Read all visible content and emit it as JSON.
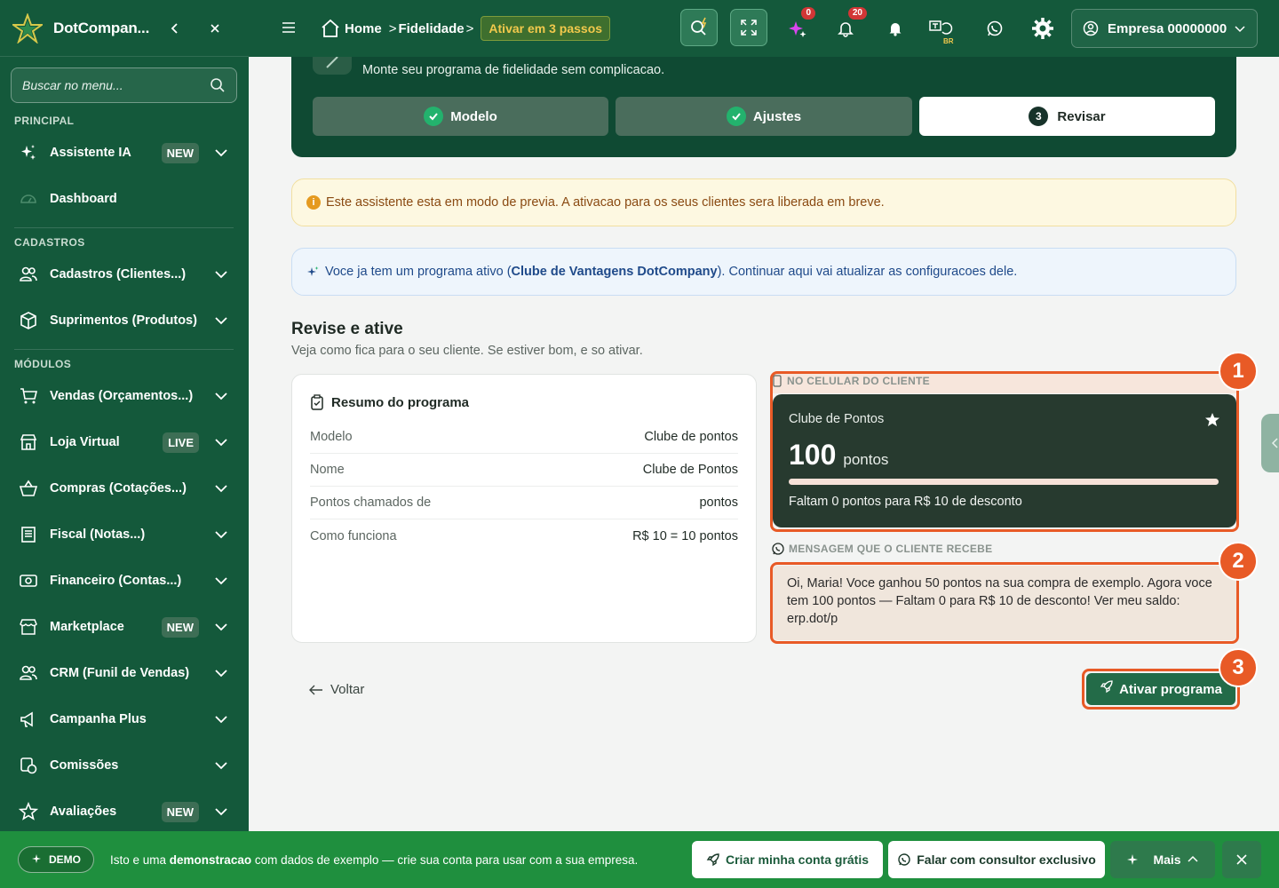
{
  "sidebar": {
    "app_name": "DotCompan...",
    "search_placeholder": "Buscar no menu...",
    "sections": {
      "principal": "PRINCIPAL",
      "cadastros": "CADASTROS",
      "modulos": "MÓDULOS"
    },
    "items": [
      {
        "label": "Assistente IA",
        "badge": "NEW",
        "icon": "sparkles-icon"
      },
      {
        "label": "Dashboard",
        "icon": "gauge-icon"
      },
      {
        "label": "Cadastros (Clientes...)",
        "icon": "users-icon"
      },
      {
        "label": "Suprimentos (Produtos)",
        "icon": "box-icon"
      },
      {
        "label": "Vendas (Orçamentos...)",
        "icon": "cart-icon"
      },
      {
        "label": "Loja Virtual",
        "badge": "LIVE",
        "icon": "store-icon"
      },
      {
        "label": "Compras (Cotações...)",
        "icon": "basket-icon"
      },
      {
        "label": "Fiscal (Notas...)",
        "icon": "receipt-icon"
      },
      {
        "label": "Financeiro (Contas...)",
        "icon": "money-icon"
      },
      {
        "label": "Marketplace",
        "badge": "NEW",
        "icon": "marketplace-icon"
      },
      {
        "label": "CRM (Funil de Vendas)",
        "icon": "users-icon"
      },
      {
        "label": "Campanha Plus",
        "icon": "megaphone-icon"
      },
      {
        "label": "Comissões",
        "icon": "commission-icon"
      },
      {
        "label": "Avaliações",
        "badge": "NEW",
        "icon": "star-icon"
      }
    ]
  },
  "topbar": {
    "breadcrumb": {
      "home": "Home",
      "current": "Fidelidade",
      "sep": ">",
      "badge": "Ativar em 3 passos"
    },
    "notif_counts": {
      "ai": "0",
      "bell": "20"
    },
    "lang": "BR",
    "account": "Empresa 00000000"
  },
  "hero": {
    "subtitle": "Monte seu programa de fidelidade sem complicacao.",
    "steps": [
      {
        "label": "Modelo",
        "state": "done"
      },
      {
        "label": "Ajustes",
        "state": "done"
      },
      {
        "label": "Revisar",
        "number": "3",
        "state": "current"
      }
    ]
  },
  "alerts": {
    "warning": "Este assistente esta em modo de previa. A ativacao para os seus clientes sera liberada em breve.",
    "info_prefix": "Voce ja tem um programa ativo (",
    "info_program": "Clube de Vantagens DotCompany",
    "info_suffix": "). Continuar aqui vai atualizar as configuracoes dele."
  },
  "review": {
    "title": "Revise e ative",
    "description": "Veja como fica para o seu cliente. Se estiver bom, e so ativar.",
    "summary_title": "Resumo do programa",
    "rows": [
      {
        "key": "Modelo",
        "value": "Clube de pontos"
      },
      {
        "key": "Nome",
        "value": "Clube de Pontos"
      },
      {
        "key": "Pontos chamados de",
        "value": "pontos"
      },
      {
        "key": "Como funciona",
        "value": "R$ 10 = 10 pontos"
      }
    ]
  },
  "preview": {
    "phone_label": "NO CELULAR DO CLIENTE",
    "card_title": "Clube de Pontos",
    "points": "100",
    "points_unit": "pontos",
    "progress": 1.0,
    "progress_text": "Faltam 0 pontos para R$ 10 de desconto",
    "message_label": "MENSAGEM QUE O CLIENTE RECEBE",
    "message": "Oi, Maria! Voce ganhou 50 pontos na sua compra de exemplo. Agora voce tem 100 pontos — Faltam 0 para R$ 10 de desconto! Ver meu saldo: erp.dot/p"
  },
  "actions": {
    "back": "Voltar",
    "activate": "Ativar programa"
  },
  "markers": [
    "1",
    "2",
    "3"
  ],
  "demo_bar": {
    "pill": "DEMO",
    "msg_prefix": "Isto e uma ",
    "msg_bold": "demonstracao",
    "msg_suffix": " com dados de exemplo — crie sua conta para usar com a sua empresa.",
    "create_account": "Criar minha conta grátis",
    "talk_consultant": "Falar com consultor exclusivo",
    "more": "Mais"
  },
  "colors": {
    "primary": "#14593b",
    "accent": "#e85a26",
    "success": "#23b26d",
    "demo": "#1f8f3e"
  }
}
